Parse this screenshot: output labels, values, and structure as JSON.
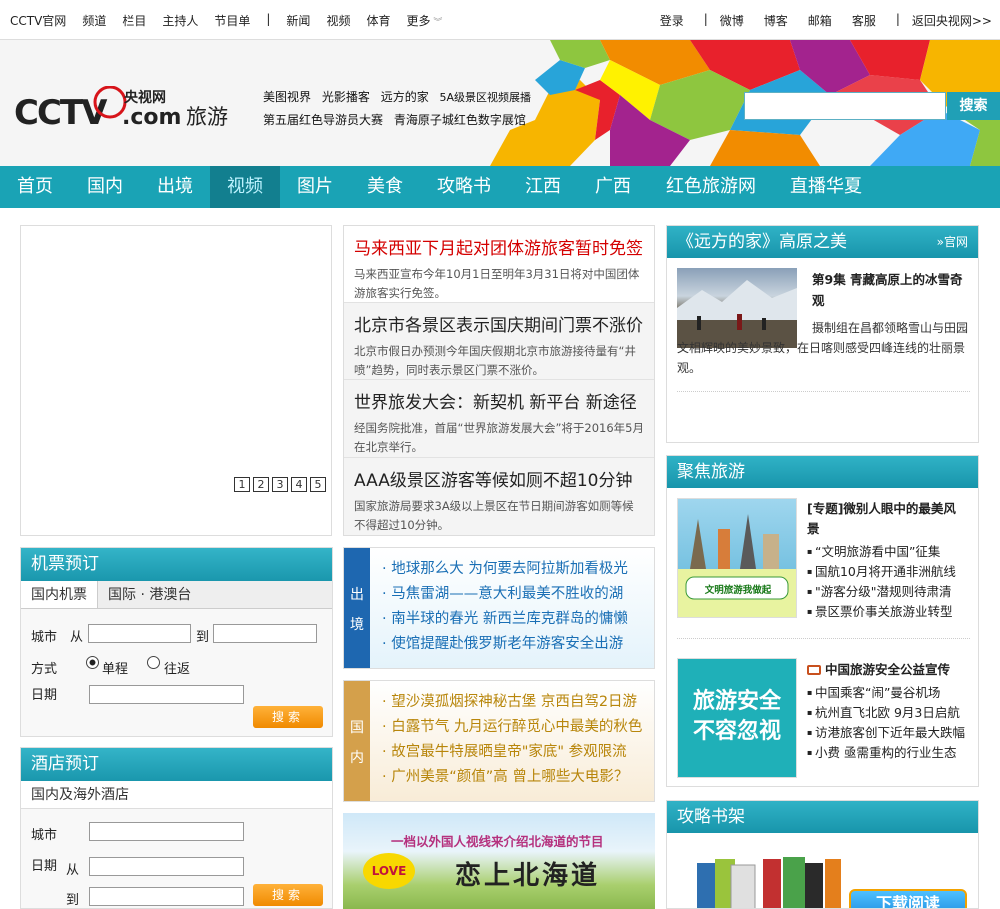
{
  "topbar": {
    "left": [
      "CCTV官网",
      "频道",
      "栏目",
      "主持人",
      "节目单",
      "新闻",
      "视频",
      "体育",
      "更多"
    ],
    "right": [
      "登录",
      "微博",
      "博客",
      "邮箱",
      "客服",
      "返回央视网>>"
    ]
  },
  "header": {
    "logo_text": "CCTV.com",
    "logo_cn": "央视网",
    "logo_section": "旅游",
    "links_row1": [
      "美图视界",
      "光影播客",
      "远方的家",
      "5A级景区视频展播"
    ],
    "links_row2": [
      "第五届红色导游员大赛",
      "青海原子城红色数字展馆"
    ],
    "search_placeholder": "",
    "search_button": "搜索"
  },
  "nav": {
    "items": [
      "首页",
      "国内",
      "出境",
      "视频",
      "图片",
      "美食",
      "攻略书",
      "江西",
      "广西",
      "红色旅游网",
      "直播华夏"
    ],
    "active": "视频"
  },
  "slider": {
    "pages": [
      "1",
      "2",
      "3",
      "4",
      "5"
    ]
  },
  "headlines": [
    {
      "title": "马来西亚下月起对团体游旅客暂时免签",
      "summary": "马来西亚宣布今年10月1日至明年3月31日将对中国团体游旅客实行免签。"
    },
    {
      "title": "北京市各景区表示国庆期间门票不涨价",
      "summary": "北京市假日办预测今年国庆假期北京市旅游接待量有“井喷”趋势，同时表示景区门票不涨价。"
    },
    {
      "title": "世界旅发大会：新契机 新平台 新途径",
      "summary": "经国务院批准，首届“世界旅游发展大会”将于2016年5月在北京举行。"
    },
    {
      "title": "AAA级景区游客等候如厕不超10分钟",
      "summary": "国家旅游局要求3A级以上景区在节日期间游客如厕等候不得超过10分钟。"
    }
  ],
  "yuanfang": {
    "title": "《远方的家》高原之美",
    "more": "官网",
    "episode_title": "第9集  青藏高原上的冰雪奇观",
    "episode_desc": "摄制组在昌都领略雪山与田园文相辉映的美妙景致，在日喀则感受四峰连线的壮丽景观。"
  },
  "flight": {
    "title": "机票预订",
    "tabs": [
      "国内机票",
      "国际 · 港澳台"
    ],
    "city": "城市",
    "from": "从",
    "to": "到",
    "mode": "方式",
    "oneway": "单程",
    "roundtrip": "往返",
    "date": "日期",
    "search": "搜索"
  },
  "hotel": {
    "title": "酒店预订",
    "tab": "国内及海外酒店",
    "city": "城市",
    "date": "日期",
    "from": "从",
    "to": "到",
    "search": "搜索"
  },
  "outbound": {
    "side": "出境",
    "items": [
      "地球那么大 为何要去阿拉斯加看极光",
      "马焦雷湖——意大利最美不胜收的湖",
      "南半球的春光 新西兰库克群岛的慵懒",
      "使馆提醒赴俄罗斯老年游客安全出游"
    ]
  },
  "domestic": {
    "side": "国内",
    "items": [
      "望沙漠孤烟探神秘古堡 京西自驾2日游",
      "白露节气 九月运行醉觅心中最美的秋色",
      "故宫最牛特展晒皇帝\"家底\" 参观限流",
      "广州美景“颜值”高 曾上哪些大电影？"
    ]
  },
  "focus": {
    "title": "聚焦旅游",
    "block1_title": "[专题]微别人眼中的最美风景",
    "block1_img_text": "文明旅游我做起",
    "block1_items": [
      "“文明旅游看中国”征集",
      "国航10月将开通非洲航线",
      "\"游客分级\"潜规则待肃清",
      "景区票价事关旅游业转型"
    ],
    "block2_title": "中国旅游安全公益宣传",
    "block2_img_text": "旅游安全不容忽视",
    "block2_items": [
      "中国乘客“闹”曼谷机场",
      "杭州直飞北欧 9月3日启航",
      "访港旅客创下近年最大跌幅",
      "小费 亟需重构的行业生态"
    ]
  },
  "banner": {
    "top_text": "一档以外国人视线来介绍北海道的节目",
    "main_text": "恋上北海道",
    "logo": "LOVE"
  },
  "guidebook": {
    "title": "攻略书架",
    "download": "下载阅读"
  }
}
